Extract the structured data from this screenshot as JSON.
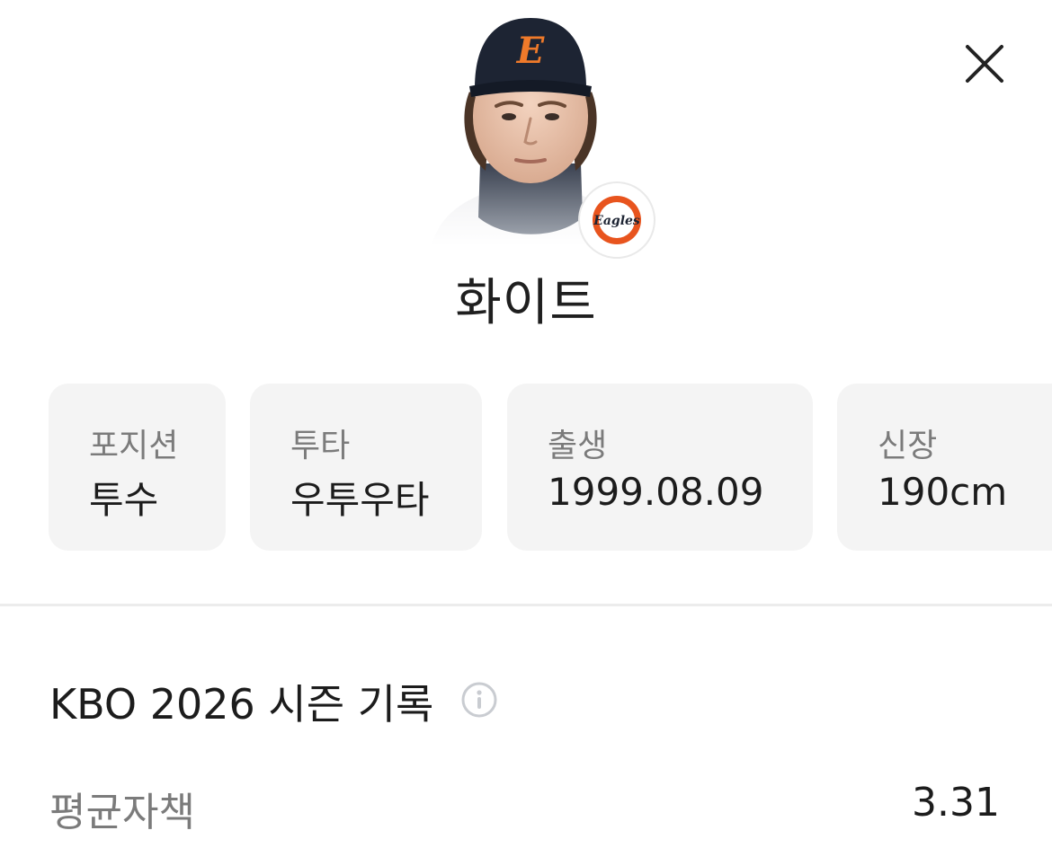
{
  "player": {
    "name": "화이트",
    "photo_icon": "player-headshot",
    "team_logo_text": "Eagles",
    "team_color": "#e8541e"
  },
  "header": {
    "close_icon": "close-icon"
  },
  "info_cards": [
    {
      "label": "포지션",
      "value": "투수"
    },
    {
      "label": "투타",
      "value": "우투우타"
    },
    {
      "label": "출생",
      "value": "1999.08.09"
    },
    {
      "label": "신장",
      "value": "190cm"
    }
  ],
  "season": {
    "title": "KBO 2026 시즌 기록",
    "info_icon": "info-icon",
    "stats": [
      {
        "label": "평균자책",
        "value": "3.31"
      }
    ]
  },
  "colors": {
    "card_bg": "#f4f4f4",
    "label_gray": "#7b7b7b",
    "text_dark": "#1c1c1c",
    "divider": "#ececec"
  }
}
